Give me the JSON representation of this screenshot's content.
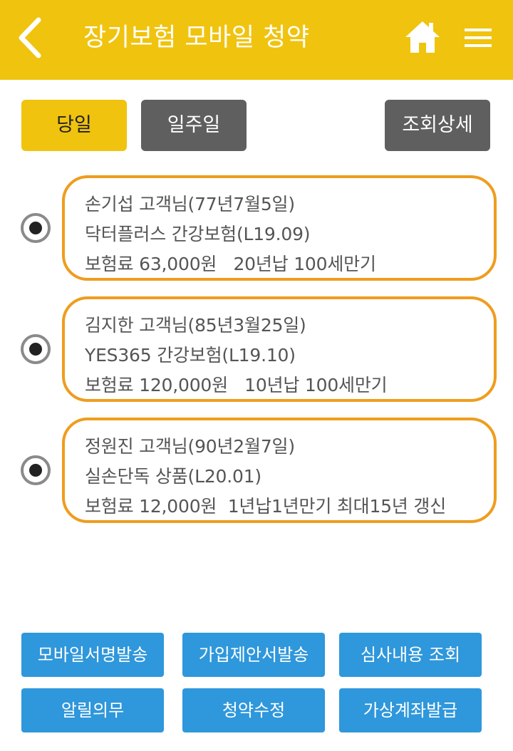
{
  "header": {
    "title": "장기보험 모바일 청약",
    "back_icon": "chevron-left-icon",
    "home_icon": "home-icon",
    "menu_icon": "hamburger-menu-icon",
    "color": "#f0c30f"
  },
  "filters": {
    "today": "당일",
    "week": "일주일",
    "detail": "조회상세"
  },
  "items": [
    {
      "customer": "손기섭 고객님(77년7월5일)",
      "product": "닥터플러스 간강보험(L19.09)",
      "terms": "보험료 63,000원   20년납 100세만기",
      "selected": true
    },
    {
      "customer": "김지한 고객님(85년3월25일)",
      "product": "YES365 간강보험(L19.10)",
      "terms": "보험료 120,000원   10년납 100세만기",
      "selected": true
    },
    {
      "customer": "정원진 고객님(90년2월7일)",
      "product": "실손단독 상품(L20.01)",
      "terms": "보험료 12,000원  1년납1년만기 최대15년 갱신",
      "selected": true
    }
  ],
  "actions": {
    "mobile_sign": "모바일서명발송",
    "proposal": "가입제안서발송",
    "review": "심사내용 조회",
    "notice": "알릴의무",
    "edit": "청약수정",
    "virtual_account": "가상계좌발급"
  },
  "colors": {
    "accent": "#f0c30f",
    "card_border": "#ef9d1e",
    "action": "#2f97db",
    "dark_button": "#5f5f5f"
  }
}
